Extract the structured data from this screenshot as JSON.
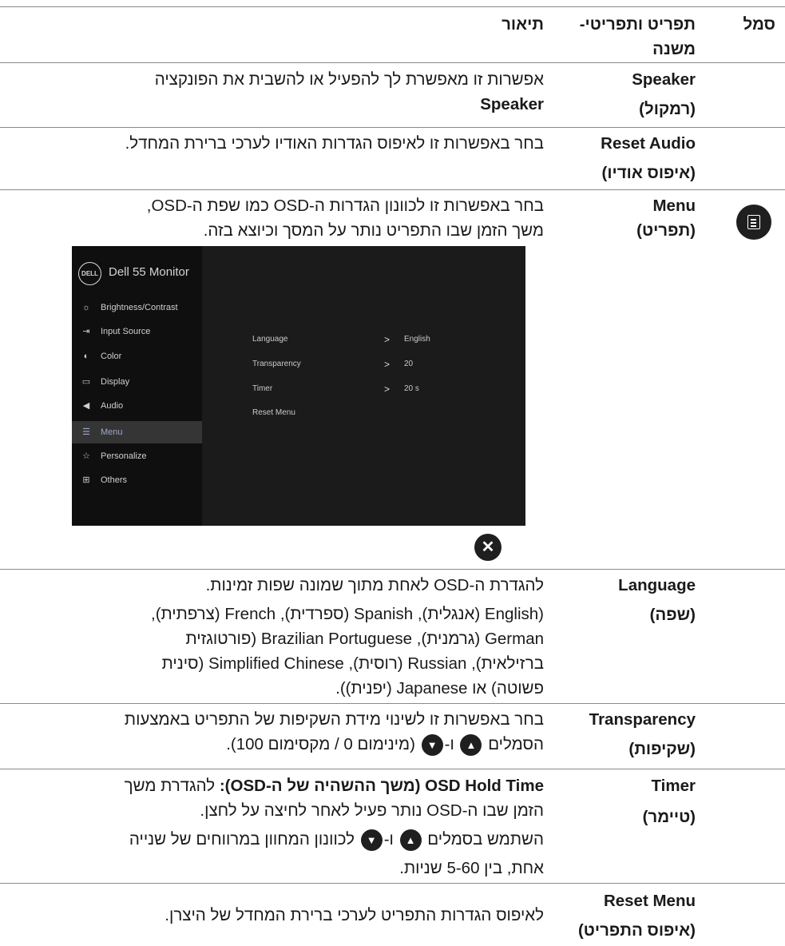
{
  "header": {
    "symbol": "סמל",
    "menu_submenu_line1": "תפריט ותפריטי-",
    "menu_submenu_line2": "משנה",
    "description": "תיאור"
  },
  "rows": {
    "speaker": {
      "name": "Speaker",
      "name_he": "(רמקול)",
      "desc_line1": "אפשרות זו מאפשרת לך להפעיל או להשבית את הפונקציה",
      "desc_line2": "Speaker"
    },
    "reset_audio": {
      "name": "Reset Audio",
      "name_he": "(איפוס אודיו)",
      "desc": "בחר באפשרות זו לאיפוס הגדרות האודיו לערכי ברירת המחדל."
    },
    "menu": {
      "icon": "menu-list-icon",
      "name": "Menu",
      "name_he": "(תפריט)",
      "desc_line1": "בחר באפשרות זו לכוונון הגדרות ה-OSD כמו שפת ה-OSD,",
      "desc_line2": "משך הזמן שבו התפריט נותר על המסך וכיוצא בזה."
    },
    "language": {
      "name": "Language",
      "name_he": "(שפה)",
      "desc_line1": "להגדרת ה-OSD לאחת מתוך שמונה שפות זמינות.",
      "desc_line2": "(English (אנגלית), Spanish (ספרדית), French (צרפתית),",
      "desc_line3": "German (גרמנית), Brazilian Portuguese (פורטוגזית",
      "desc_line4": "ברזילאית), Russian (רוסית), Simplified Chinese (סינית",
      "desc_line5": "פשוטה) או Japanese (יפנית))."
    },
    "transparency": {
      "name": "Transparency",
      "name_he": "(שקיפות)",
      "desc_line1": "בחר באפשרות זו לשינוי מידת השקיפות של התפריט באמצעות",
      "desc_line2_a": "הסמלים",
      "desc_line2_b": "ו-",
      "desc_line2_c": "(מינימום 0 / מקסימום 100)."
    },
    "timer": {
      "name": "Timer",
      "name_he": "(טיימר)",
      "desc_bold": "OSD Hold Time (משך ההשהיה של ה-OSD):",
      "desc_line1_rest": "להגדרת משך",
      "desc_line2": "הזמן שבו ה-OSD נותר פעיל לאחר לחיצה על לחצן.",
      "desc_line3_a": "השתמש בסמלים",
      "desc_line3_b": "ו-",
      "desc_line3_c": "לכוונון המחוון במרווחים של שנייה",
      "desc_line4": "אחת, בין 5-60 שניות."
    },
    "reset_menu": {
      "name": "Reset Menu",
      "name_he": "(איפוס התפריט)",
      "desc": "לאיפוס הגדרות התפריט לערכי ברירת המחדל של היצרן."
    }
  },
  "osd": {
    "brand": "DELL",
    "title": "Dell 55 Monitor",
    "items": [
      {
        "label": "Brightness/Contrast",
        "icon": "brightness-icon"
      },
      {
        "label": "Input Source",
        "icon": "input-source-icon"
      },
      {
        "label": "Color",
        "icon": "color-palette-icon"
      },
      {
        "label": "Display",
        "icon": "display-icon"
      },
      {
        "label": "Audio",
        "icon": "speaker-icon"
      },
      {
        "label": "Menu",
        "icon": "menu-icon",
        "selected": true
      },
      {
        "label": "Personalize",
        "icon": "star-icon"
      },
      {
        "label": "Others",
        "icon": "others-icon"
      }
    ],
    "options": [
      {
        "label": "Language",
        "value": "English"
      },
      {
        "label": "Transparency",
        "value": "20"
      },
      {
        "label": "Timer",
        "value": "20 s"
      },
      {
        "label": "Reset Menu",
        "value": ""
      }
    ],
    "close_icon": "close-icon"
  },
  "icons": {
    "up": "up-arrow-icon",
    "down": "down-arrow-icon"
  }
}
